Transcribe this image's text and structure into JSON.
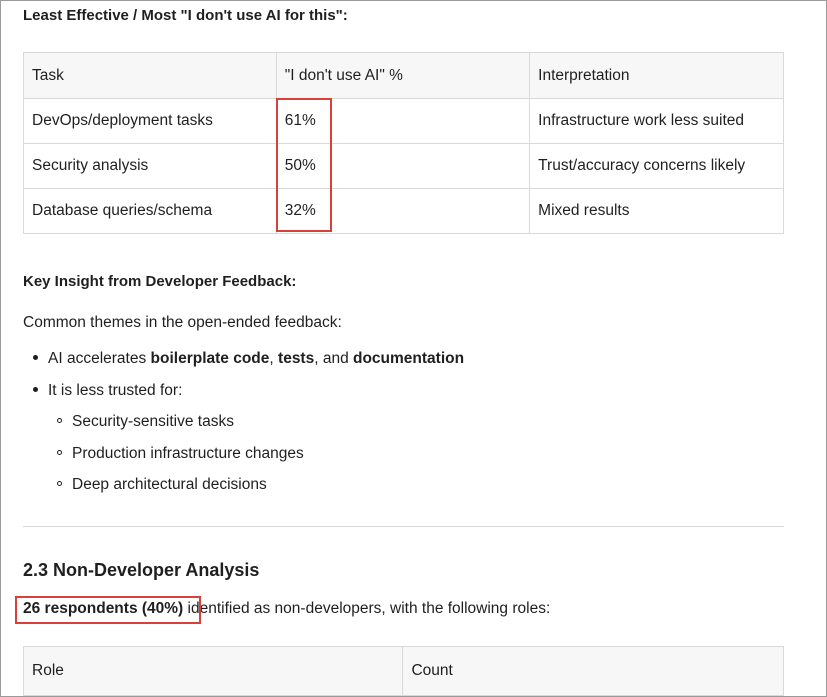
{
  "least_effective": {
    "heading": "Least Effective / Most \"I don't use AI for this\":",
    "table": {
      "headers": [
        "Task",
        "\"I don't use AI\" %",
        "Interpretation"
      ],
      "rows": [
        {
          "task": "DevOps/deployment tasks",
          "pct": "61%",
          "interp": "Infrastructure work less suited"
        },
        {
          "task": "Security analysis",
          "pct": "50%",
          "interp": "Trust/accuracy concerns likely"
        },
        {
          "task": "Database queries/schema",
          "pct": "32%",
          "interp": "Mixed results"
        }
      ]
    }
  },
  "insight": {
    "heading": "Key Insight from Developer Feedback:",
    "intro": "Common themes in the open-ended feedback:",
    "bullet1": {
      "prefix": "AI accelerates ",
      "b1": "boilerplate code",
      "sep1": ", ",
      "b2": "tests",
      "sep2": ", and ",
      "b3": "documentation"
    },
    "bullet2": "It is less trusted for:",
    "sub_bullets": [
      "Security-sensitive tasks",
      "Production infrastructure changes",
      "Deep architectural decisions"
    ]
  },
  "non_dev": {
    "title": "2.3 Non-Developer Analysis",
    "highlight": "26 respondents (40%)",
    "rest": " identified as non-developers, with the following roles:",
    "table_headers": [
      "Role",
      "Count"
    ]
  },
  "colors": {
    "highlight_border": "#d9403a",
    "table_border": "#d9d9d9",
    "header_bg": "#f7f7f7"
  }
}
